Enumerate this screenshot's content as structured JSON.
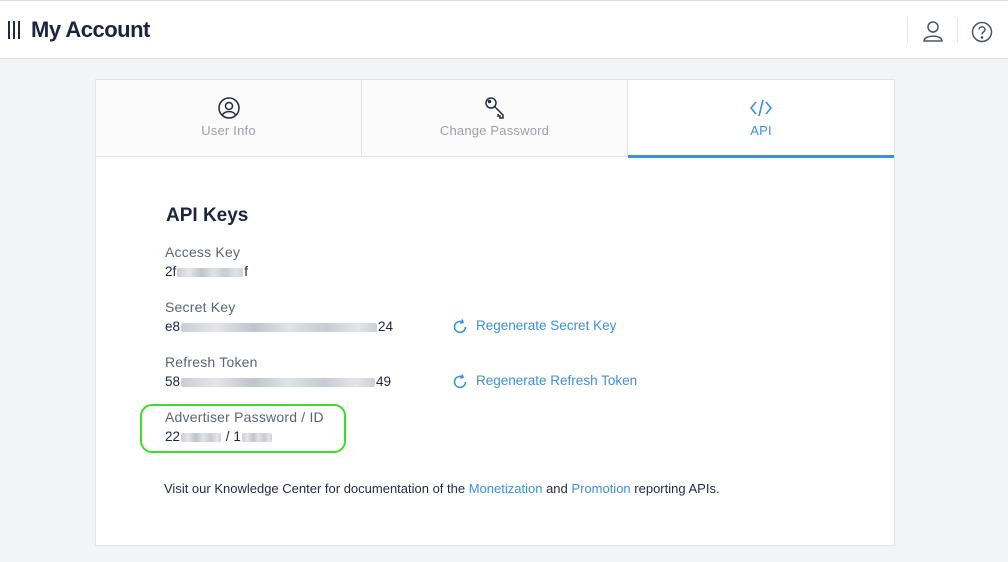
{
  "header": {
    "title": "My Account",
    "icons": [
      "menu-icon",
      "user-icon",
      "help-icon"
    ]
  },
  "tabs": [
    {
      "label": "User Info",
      "icon": "user-circle-icon",
      "active": false
    },
    {
      "label": "Change Password",
      "icon": "key-icon",
      "active": false
    },
    {
      "label": "API",
      "icon": "code-icon",
      "active": true
    }
  ],
  "api_keys": {
    "title": "API Keys",
    "access_key": {
      "label": "Access Key",
      "prefix": "2f",
      "suffix": "f"
    },
    "secret_key": {
      "label": "Secret Key",
      "prefix": "e8",
      "suffix": "24",
      "action": "Regenerate Secret Key"
    },
    "refresh_token": {
      "label": "Refresh Token",
      "prefix": "58",
      "suffix": "49",
      "action": "Regenerate Refresh Token"
    },
    "advertiser": {
      "label": "Advertiser Password / ID",
      "password_prefix": "22",
      "separator": "/",
      "id_prefix": "1"
    }
  },
  "footer": {
    "text_before": "Visit our Knowledge Center for documentation of the",
    "link_monetization": "Monetization",
    "text_and": "and",
    "link_promotion": "Promotion",
    "text_after": "reporting APIs."
  },
  "colors": {
    "accent": "#3d8fe0",
    "highlight": "#3ddc2a",
    "title": "#1b2540"
  }
}
